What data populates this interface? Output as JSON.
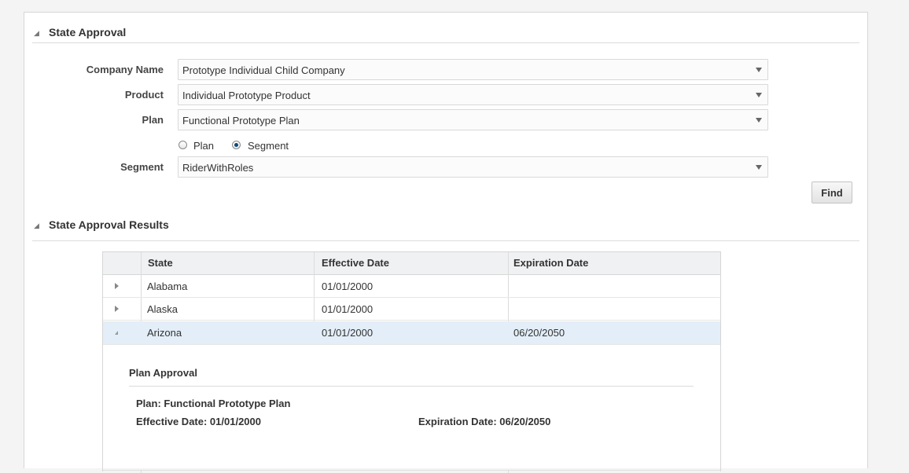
{
  "state_approval": {
    "title": "State Approval",
    "company_label": "Company Name",
    "company_value": "Prototype Individual Child Company",
    "product_label": "Product",
    "product_value": "Individual Prototype Product",
    "plan_label": "Plan",
    "plan_value": "Functional Prototype Plan",
    "radio_plan_label": "Plan",
    "radio_segment_label": "Segment",
    "selected_radio": "Segment",
    "segment_label": "Segment",
    "segment_value": "RiderWithRoles",
    "find_label": "Find"
  },
  "results": {
    "title": "State Approval Results",
    "columns": [
      "State",
      "Effective Date",
      "Expiration Date"
    ],
    "rows": [
      {
        "state": "Alabama",
        "effective": "01/01/2000",
        "expiration": ""
      },
      {
        "state": "Alaska",
        "effective": "01/01/2000",
        "expiration": ""
      },
      {
        "state": "Arizona",
        "effective": "01/01/2000",
        "expiration": "06/20/2050"
      }
    ],
    "detail": {
      "title": "Plan Approval",
      "plan_line": "Plan: Functional Prototype Plan",
      "effective_line": "Effective Date: 01/01/2000",
      "expiration_line": "Expiration Date: 06/20/2050"
    }
  },
  "colors": {
    "selected_row": "#e3eef8",
    "header_bg": "#f0f1f3",
    "radio_fill": "#0a4a7a"
  }
}
